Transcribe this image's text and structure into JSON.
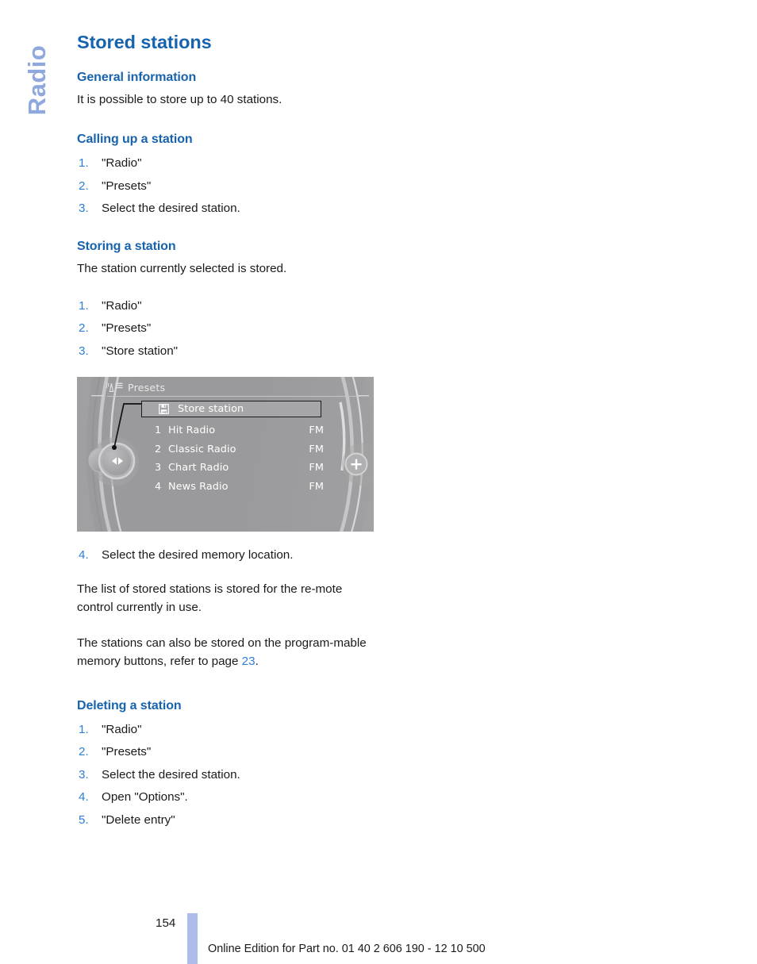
{
  "chapter_tab": {
    "label": "Radio"
  },
  "page": {
    "title": "Stored stations",
    "number": "154",
    "footer_note": "Online Edition for Part no. 01 40 2 606 190 - 12 10 500"
  },
  "sections": {
    "general": {
      "heading": "General information",
      "body": "It is possible to store up to 40 stations."
    },
    "calling_up": {
      "heading": "Calling up a station",
      "steps": [
        "\"Radio\"",
        "\"Presets\"",
        "Select the desired station."
      ]
    },
    "storing": {
      "heading": "Storing a station",
      "intro": "The station currently selected is stored.",
      "steps": [
        "\"Radio\"",
        "\"Presets\"",
        "\"Store station\""
      ],
      "step4_number": "4.",
      "step4_text": "Select the desired memory location.",
      "note1": "The list of stored stations is stored for the re‑mote control currently in use.",
      "note2_before": "The stations can also be stored on the program‑mable memory buttons, refer to page ",
      "note2_pageref": "23",
      "note2_after": "."
    },
    "deleting": {
      "heading": "Deleting a station",
      "steps": [
        "\"Radio\"",
        "\"Presets\"",
        "Select the desired station.",
        "Open \"Options\".",
        "\"Delete entry\""
      ]
    }
  },
  "idrive_figure": {
    "header_icon": "radio-list-icon",
    "header_title": "Presets",
    "store_row": {
      "icon": "floppy-save-icon",
      "label": "Store station"
    },
    "presets": [
      {
        "index": "1",
        "name": "Hit Radio",
        "band": "FM"
      },
      {
        "index": "2",
        "name": "Classic Radio",
        "band": "FM"
      },
      {
        "index": "3",
        "name": "Chart Radio",
        "band": "FM"
      },
      {
        "index": "4",
        "name": "News Radio",
        "band": "FM"
      }
    ],
    "controller_icon": "idrive-controller-left-right-icon",
    "plus_button_icon": "plus-button-icon"
  },
  "colors": {
    "heading_blue": "#1763ad",
    "step_number_blue": "#2d7fd2",
    "chapter_tab_blue": "#8fa8dd",
    "footer_bar_blue": "#adbce8",
    "screen_gray": "#9a9a9c"
  }
}
